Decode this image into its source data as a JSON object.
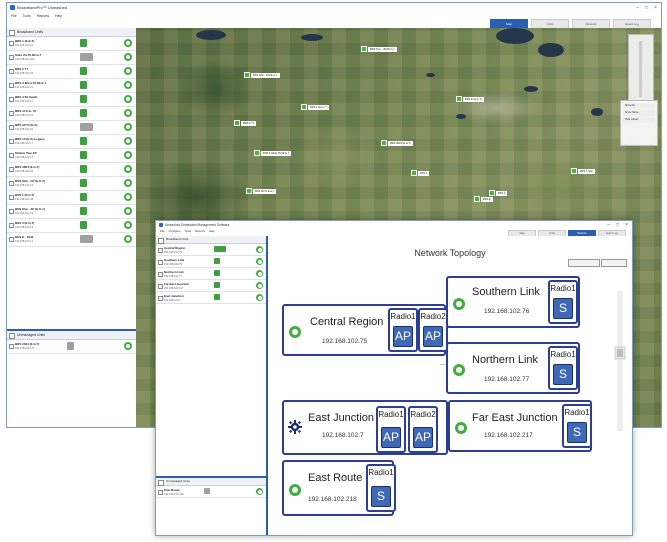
{
  "win1": {
    "title": "BroadbandPro™ Unleashed",
    "menu": [
      "File",
      "Tools",
      "Reports",
      "Help"
    ],
    "tabs": [
      "Map",
      "Units",
      "Network",
      "Event Log"
    ],
    "active_tab": 0,
    "window_controls": [
      "–",
      "□",
      "×"
    ],
    "sidebar_header": "Broadband Units",
    "units": [
      {
        "name": "BRS 1 (E.G.7)",
        "ip": "192.168.102.10"
      },
      {
        "name": "Sites 2H 45.0E.G.7",
        "ip": "192.168.102.200"
      },
      {
        "name": "BRS 2 77",
        "ip": "192.168.102.23"
      },
      {
        "name": "BRS 3 West 45.0E.G.7",
        "ip": "192.168.102.21"
      },
      {
        "name": "BRS 4 36 South",
        "ip": "192.168.102.11"
      },
      {
        "name": "BRS 11 E.G. 37",
        "ip": "192.168.102.10"
      },
      {
        "name": "BRS AP74 (E.G)",
        "ip": "192.168.102.22"
      },
      {
        "name": "BRS 10 (E.G) Legacy",
        "ip": "192.168.102.17"
      },
      {
        "name": "Station Two AP",
        "ip": "192.168.102.17"
      },
      {
        "name": "BRS 3824 (E.G.7)",
        "ip": "192.168.102.22"
      },
      {
        "name": "BSS Stat - CP (E.G.7)",
        "ip": "192.168.102.16"
      },
      {
        "name": "BSS 1 (E.G.7)",
        "ip": "192.168.102.38"
      },
      {
        "name": "BSS Stat - AP (E.G.7)",
        "ip": "192.168.102.19"
      },
      {
        "name": "BSS 3 (E.G.7)",
        "ip": "192.168.102.13"
      },
      {
        "name": "BSS E - 1040",
        "ip": "192.168.102.14"
      }
    ],
    "panel2_header": "Unmanaged Units",
    "panel2_units": [
      {
        "name": "BRS 2024 (E.G.7)",
        "ip": "192.168.102.127"
      }
    ],
    "map_pins": [
      {
        "label": "BRS Twn - 45.0E.G.7"
      },
      {
        "label": "BSS Stat - 45.0E.G.7"
      },
      {
        "label": "BRS 2 (E.G.7)"
      },
      {
        "label": "BRS E (E.G.7)"
      },
      {
        "label": "BRS 3 77"
      },
      {
        "label": "BSS 4 West 45.0E.G.7"
      },
      {
        "label": "BSS AP74 E.G.7"
      },
      {
        "label": "BRS 3824 (E.G.7)"
      },
      {
        "label": "BSS 1"
      },
      {
        "label": "BSS 3"
      },
      {
        "label": "BRS E"
      },
      {
        "label": "BRS 1 Stat"
      }
    ],
    "map_legend": [
      "Show All",
      "Show Name",
      "Hide Labels"
    ]
  },
  "win2": {
    "title": "Unleashed Embedded Management Software",
    "menu": [
      "File",
      "Configure",
      "Tools",
      "Reports",
      "Help"
    ],
    "tabs": [
      "Map",
      "Units",
      "Network",
      "Event Log"
    ],
    "active_tab": 2,
    "window_controls": [
      "–",
      "□",
      "×"
    ],
    "sidebar_header": "Broadband Units",
    "units": [
      {
        "name": "Central Region",
        "ip": "192.168.102.75"
      },
      {
        "name": "Southern Link",
        "ip": "192.168.102.76"
      },
      {
        "name": "Northern Link",
        "ip": "192.168.102.77"
      },
      {
        "name": "Far East Junction",
        "ip": "192.168.102.217"
      },
      {
        "name": "East Junction",
        "ip": "192.168.102.7"
      }
    ],
    "lower_header": "Unmanaged Units",
    "lower_units": [
      {
        "name": "East Route",
        "ip": "192.168.102.218"
      }
    ],
    "topology_title": "Network Topology",
    "nodes": [
      {
        "name": "Central Region",
        "ip": "192.168.102.75",
        "status": "ok",
        "radios": [
          {
            "label": "Radio1",
            "mode": "AP"
          },
          {
            "label": "Radio2",
            "mode": "AP"
          }
        ]
      },
      {
        "name": "Southern Link",
        "ip": "192.168.102.76",
        "status": "ok",
        "radios": [
          {
            "label": "Radio1",
            "mode": "S"
          }
        ]
      },
      {
        "name": "Northern Link",
        "ip": "192.168.102.77",
        "status": "ok",
        "radios": [
          {
            "label": "Radio1",
            "mode": "S"
          }
        ]
      },
      {
        "name": "East Junction",
        "ip": "192.168.102.7",
        "status": "gear",
        "radios": [
          {
            "label": "Radio1",
            "mode": "AP"
          },
          {
            "label": "Radio2",
            "mode": "AP"
          }
        ]
      },
      {
        "name": "Far East Junction",
        "ip": "192.168.102.217",
        "status": "ok",
        "radios": [
          {
            "label": "Radio1",
            "mode": "S"
          }
        ]
      },
      {
        "name": "East Route",
        "ip": "192.168.102.218",
        "status": "ok",
        "radios": [
          {
            "label": "Radio1",
            "mode": "S"
          }
        ]
      }
    ]
  },
  "colors": {
    "accent": "#2a5fb0",
    "node_border": "#2c3f95",
    "radio_button": "#3d69b7",
    "status_ok": "#3fae3f",
    "status_gear": "#1c2e6b"
  }
}
